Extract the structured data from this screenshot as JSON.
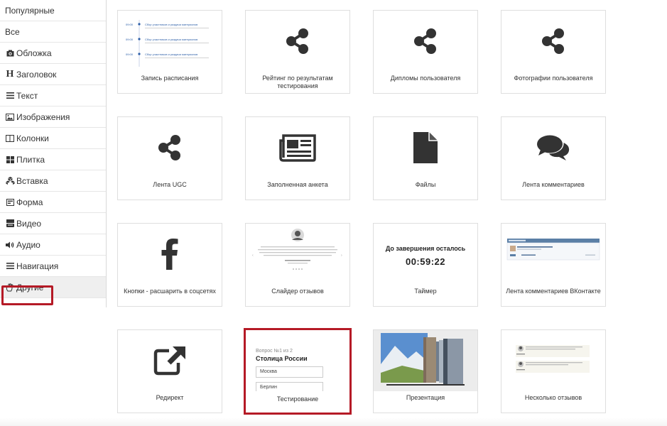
{
  "sidebar": {
    "items": [
      {
        "label": "Популярные",
        "icon": "none"
      },
      {
        "label": "Все",
        "icon": "none"
      },
      {
        "label": "Обложка",
        "icon": "camera-icon"
      },
      {
        "label": "Заголовок",
        "icon": "heading-icon"
      },
      {
        "label": "Текст",
        "icon": "text-lines-icon"
      },
      {
        "label": "Изображения",
        "icon": "image-icon"
      },
      {
        "label": "Колонки",
        "icon": "columns-icon"
      },
      {
        "label": "Плитка",
        "icon": "tiles-icon"
      },
      {
        "label": "Вставка",
        "icon": "cubes-icon"
      },
      {
        "label": "Форма",
        "icon": "form-icon"
      },
      {
        "label": "Видео",
        "icon": "youtube-icon"
      },
      {
        "label": "Аудио",
        "icon": "volume-icon"
      },
      {
        "label": "Навигация",
        "icon": "bars-icon"
      },
      {
        "label": "Другие",
        "icon": "hand-icon",
        "active": true
      }
    ]
  },
  "cards": [
    {
      "label": "Запись расписания"
    },
    {
      "label": "Рейтинг по результатам тестирования"
    },
    {
      "label": "Дипломы пользователя"
    },
    {
      "label": "Фотографии пользователя"
    },
    {
      "label": "Лента UGC"
    },
    {
      "label": "Заполненная анкета"
    },
    {
      "label": "Файлы"
    },
    {
      "label": "Лента комментариев"
    },
    {
      "label": "Кнопки - расшарить в соцсетях"
    },
    {
      "label": "Слайдер отзывов"
    },
    {
      "label": "Таймер"
    },
    {
      "label": "Лента комментариев ВКонтакте"
    },
    {
      "label": "Редирект"
    },
    {
      "label": "Тестирование",
      "selected": true
    },
    {
      "label": "Презентация"
    },
    {
      "label": "Несколько отзывов"
    }
  ],
  "schedule_preview": {
    "times": [
      "09:00",
      "09:00",
      "09:00"
    ],
    "titles": [
      "Сбор участников и раздача материалов",
      "Сбор участников и раздача материалов",
      "Сбор участников и раздача материалов"
    ]
  },
  "timer_preview": {
    "title": "До завершения осталось",
    "value": "00:59:22"
  },
  "quiz_preview": {
    "question_no": "Вопрос №1 из 2",
    "question": "Столица России",
    "options": [
      "Москва",
      "Берлин"
    ]
  },
  "colors": {
    "accent": "#b51a26",
    "icon": "#333333"
  }
}
